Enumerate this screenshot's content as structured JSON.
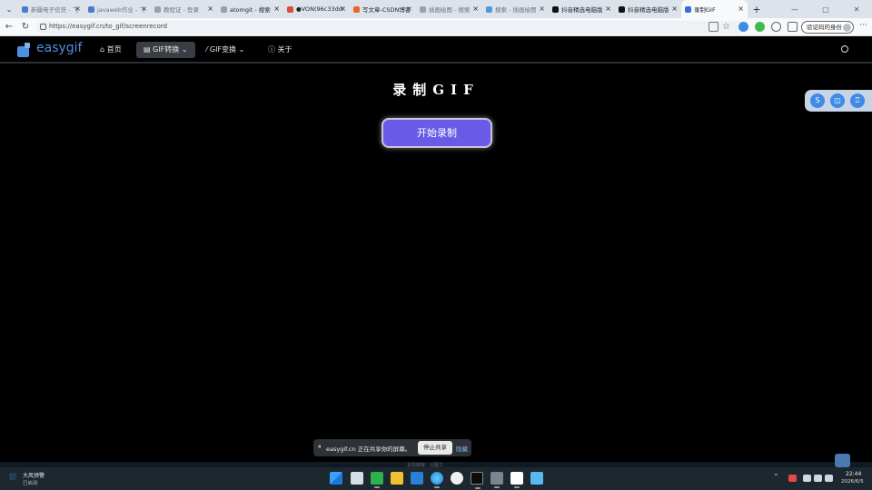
{
  "browser": {
    "tabs": [
      {
        "label": "新疆电子信贷 - 飞",
        "color": "#4a7bd0",
        "active": false,
        "dark": false
      },
      {
        "label": "javaweb作业 - 飞",
        "color": "#4a7bd0",
        "active": false,
        "dark": false
      },
      {
        "label": "教程证 - 登录",
        "color": "#9aa0a8",
        "active": false,
        "dark": false
      },
      {
        "label": "atomgit - 搜索",
        "color": "#9aa0a8",
        "active": false,
        "dark": true
      },
      {
        "label": "●VON(96c33dd3)",
        "color": "#e04a3a",
        "active": false,
        "dark": true
      },
      {
        "label": "写文章-CSDN博客",
        "color": "#e8652e",
        "active": false,
        "dark": true
      },
      {
        "label": "插画绘图 - 搜索",
        "color": "#9aa0a8",
        "active": false,
        "dark": false
      },
      {
        "label": "搜索 - 插画绘图",
        "color": "#4a9ae0",
        "active": false,
        "dark": false
      },
      {
        "label": "抖音精选电脑版",
        "color": "#111111",
        "active": false,
        "dark": true
      },
      {
        "label": "抖音精选电脑版",
        "color": "#111111",
        "active": false,
        "dark": true
      },
      {
        "label": "录制GIF",
        "color": "#3a6fd8",
        "active": true,
        "dark": true
      }
    ],
    "new_tab": "+",
    "url": "https://easygif.cn/to_gif/screenrecord",
    "verify_label": "验证码的身份",
    "more": "···"
  },
  "site": {
    "logo_text": "easygif",
    "menu": [
      {
        "label": "首页",
        "icon": "home-icon"
      },
      {
        "label": "GIF转换",
        "icon": "grid-icon",
        "caret": "⌄"
      },
      {
        "label": "GIF变换",
        "icon": "wand-icon",
        "caret": "⌄"
      },
      {
        "label": "关于",
        "icon": "info-icon"
      }
    ],
    "accent": "#4d8fe0"
  },
  "main": {
    "title": "录制GIF",
    "record_button": "开始录制",
    "button_color": "#6a5ae8"
  },
  "share_banner": {
    "text": "easygif.cn 正在共享你的屏幕。",
    "stop": "停止共享",
    "hide": "隐藏"
  },
  "footer_text": "友情链接：云图工",
  "taskbar": {
    "weather_line1": "大风预警",
    "weather_line2": "已启动",
    "time": "22:44",
    "date": "2026/6/5"
  }
}
